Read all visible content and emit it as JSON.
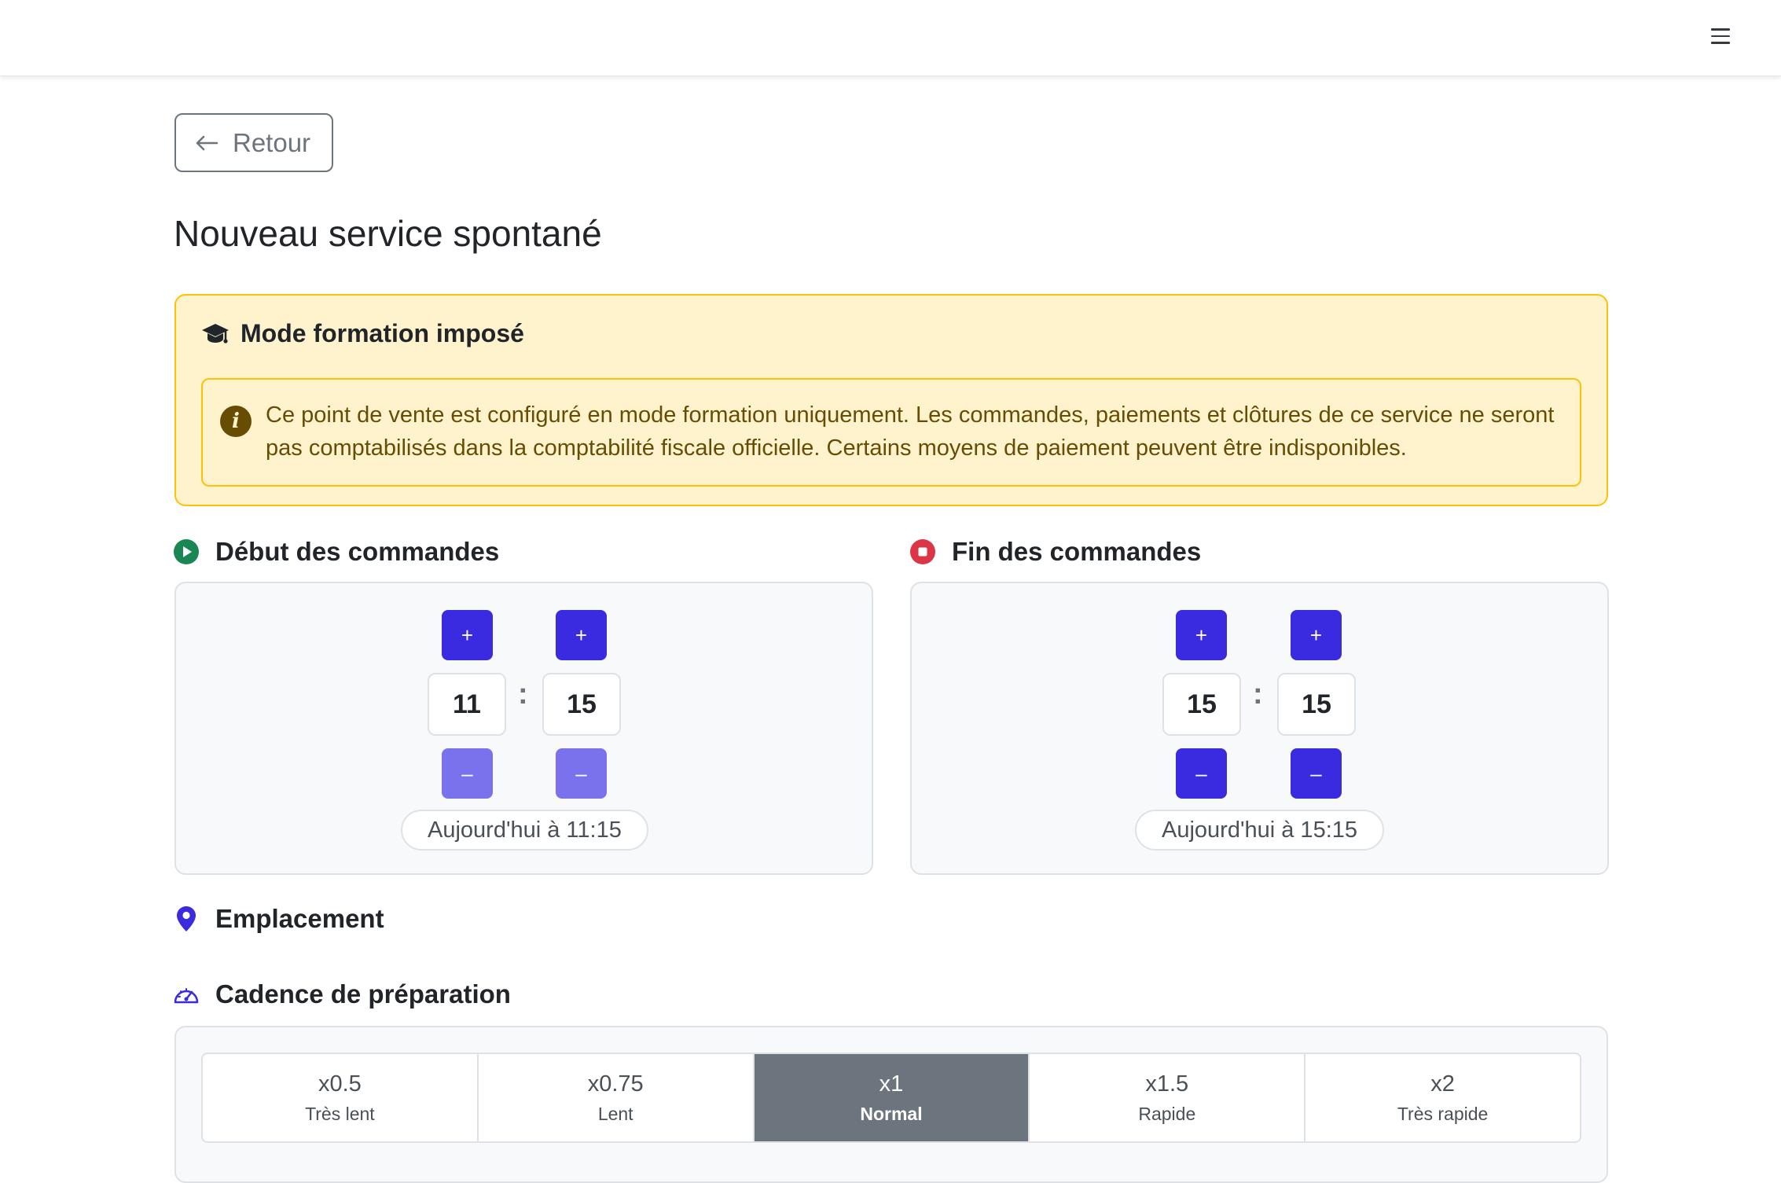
{
  "header": {
    "menu_icon": "hamburger-menu-icon"
  },
  "back_button": {
    "label": "Retour",
    "icon": "arrow-left-icon"
  },
  "page_title": "Nouveau service spontané",
  "training_alert": {
    "title": "Mode formation imposé",
    "title_icon": "graduation-cap-icon",
    "info_icon": "info-icon",
    "message": "Ce point de vente est configuré en mode formation uniquement. Les commandes, paiements et clôtures de ce service ne seront pas comptabilisés dans la comptabilité fiscale officielle. Certains moyens de paiement peuvent être indisponibles."
  },
  "start": {
    "title": "Début des commandes",
    "icon": "play-circle-icon",
    "hours": "11",
    "minutes": "15",
    "separator": ":",
    "plus": "+",
    "minus": "–",
    "summary": "Aujourd'hui à 11:15"
  },
  "end": {
    "title": "Fin des commandes",
    "icon": "stop-circle-icon",
    "hours": "15",
    "minutes": "15",
    "separator": ":",
    "plus": "+",
    "minus": "–",
    "summary": "Aujourd'hui à 15:15"
  },
  "location": {
    "title": "Emplacement",
    "icon": "map-pin-icon"
  },
  "pace": {
    "title": "Cadence de préparation",
    "icon": "speedometer-icon",
    "options": [
      {
        "mult": "x0.5",
        "label": "Très lent"
      },
      {
        "mult": "x0.75",
        "label": "Lent"
      },
      {
        "mult": "x1",
        "label": "Normal"
      },
      {
        "mult": "x1.5",
        "label": "Rapide"
      },
      {
        "mult": "x2",
        "label": "Très rapide"
      }
    ],
    "selected": "x1"
  },
  "colors": {
    "primary": "#3a2be0",
    "primary_disabled": "#7a71ec",
    "warning_bg": "#fff3cd",
    "warning_border": "#ffc107",
    "warning_text": "#664d03",
    "success": "#198754",
    "danger": "#dc3545",
    "active_segment": "#6c757d"
  }
}
